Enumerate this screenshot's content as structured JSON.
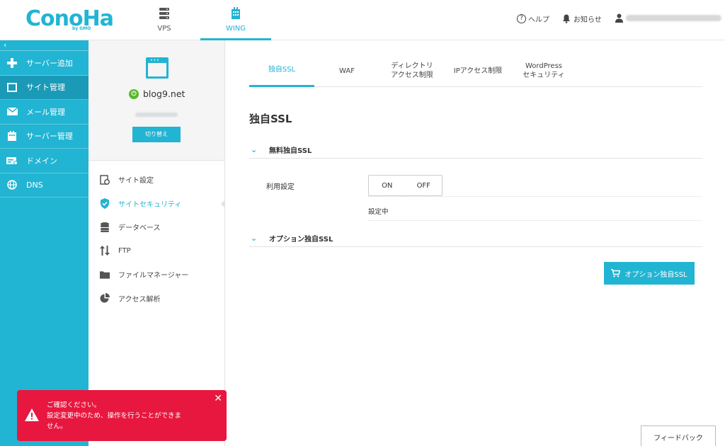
{
  "header": {
    "logo_text": "ConoHa",
    "logo_sub": "by GMO",
    "nav": [
      {
        "label": "VPS",
        "icon": "server-icon"
      },
      {
        "label": "WING",
        "icon": "building-icon"
      }
    ],
    "help_label": "ヘルプ",
    "notice_label": "お知らせ"
  },
  "sidebar": {
    "collapse": "‹",
    "items": [
      {
        "label": "サーバー追加",
        "icon": "plus-icon"
      },
      {
        "label": "サイト管理",
        "icon": "window-icon"
      },
      {
        "label": "メール管理",
        "icon": "mail-icon"
      },
      {
        "label": "サーバー管理",
        "icon": "server-box-icon"
      },
      {
        "label": "ドメイン",
        "icon": "domain-icon"
      },
      {
        "label": "DNS",
        "icon": "globe-icon"
      }
    ]
  },
  "site": {
    "name": "blog9.net",
    "switch_label": "切り替え"
  },
  "mid_menu": [
    {
      "label": "サイト設定",
      "icon": "site-settings-icon"
    },
    {
      "label": "サイトセキュリティ",
      "icon": "shield-icon"
    },
    {
      "label": "データベース",
      "icon": "database-icon"
    },
    {
      "label": "FTP",
      "icon": "transfer-icon"
    },
    {
      "label": "ファイルマネージャー",
      "icon": "folder-icon"
    },
    {
      "label": "アクセス解析",
      "icon": "pie-chart-icon"
    }
  ],
  "tabs": [
    {
      "line1": "独自SSL",
      "line2": ""
    },
    {
      "line1": "WAF",
      "line2": ""
    },
    {
      "line1": "ディレクトリ",
      "line2": "アクセス制限"
    },
    {
      "line1": "IPアクセス制限",
      "line2": ""
    },
    {
      "line1": "WordPress",
      "line2": "セキュリティ"
    }
  ],
  "main": {
    "title": "独自SSL",
    "accordion1": "無料独自SSL",
    "setting_label": "利用設定",
    "toggle_on": "ON",
    "toggle_off": "OFF",
    "status": "設定中",
    "accordion2": "オプション独自SSL",
    "option_button": "オプション独自SSL",
    "feedback": "フィードバック"
  },
  "alert": {
    "line1": "ご確認ください。",
    "line2": "設定変更中のため、操作を行うことができま",
    "line3": "せん。",
    "close": "✕"
  },
  "colors": {
    "accent": "#22b4d3",
    "sidebar_active": "#1a9ab7",
    "alert": "#e8173f",
    "power": "#5bb82b"
  }
}
